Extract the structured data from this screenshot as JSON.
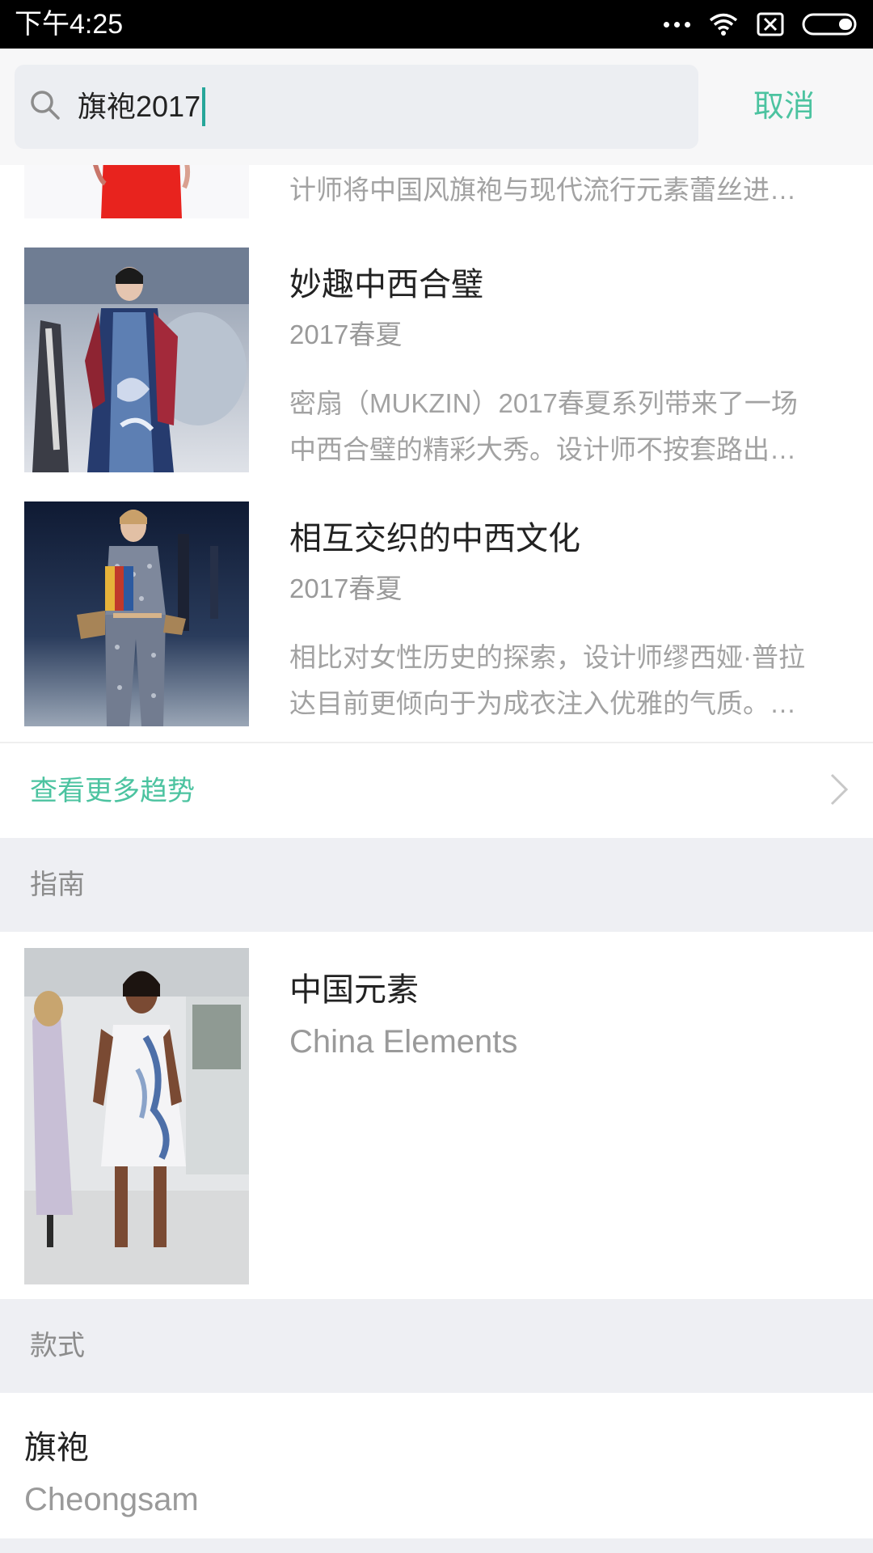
{
  "status_bar": {
    "time": "下午4:25",
    "icons": [
      "more-dots-icon",
      "wifi-icon",
      "no-sim-icon",
      "battery-icon"
    ]
  },
  "search": {
    "query": "旗袍2017",
    "cancel_label": "取消",
    "icon": "search-icon"
  },
  "trends": {
    "items": [
      {
        "title": "",
        "subtitle": "",
        "description_tail": "计师将中国风旗袍与现代流行元素蕾丝进…"
      },
      {
        "title": "妙趣中西合璧",
        "subtitle": "2017春夏",
        "description_line1": "密扇（MUKZIN）2017春夏系列带来了一场",
        "description_line2": "中西合璧的精彩大秀。设计师不按套路出…"
      },
      {
        "title": "相互交织的中西文化",
        "subtitle": "2017春夏",
        "description_line1": "相比对女性历史的探索，设计师缪西娅·普拉",
        "description_line2": "达目前更倾向于为成衣注入优雅的气质。…"
      }
    ],
    "more_label": "查看更多趋势"
  },
  "guide": {
    "section_label": "指南",
    "item": {
      "title": "中国元素",
      "subtitle": "China Elements"
    }
  },
  "style": {
    "section_label": "款式",
    "item": {
      "title": "旗袍",
      "subtitle": "Cheongsam"
    }
  },
  "colors": {
    "accent": "#4cc3a0",
    "caret": "#26a69a",
    "section_bg": "#eeeff3"
  }
}
